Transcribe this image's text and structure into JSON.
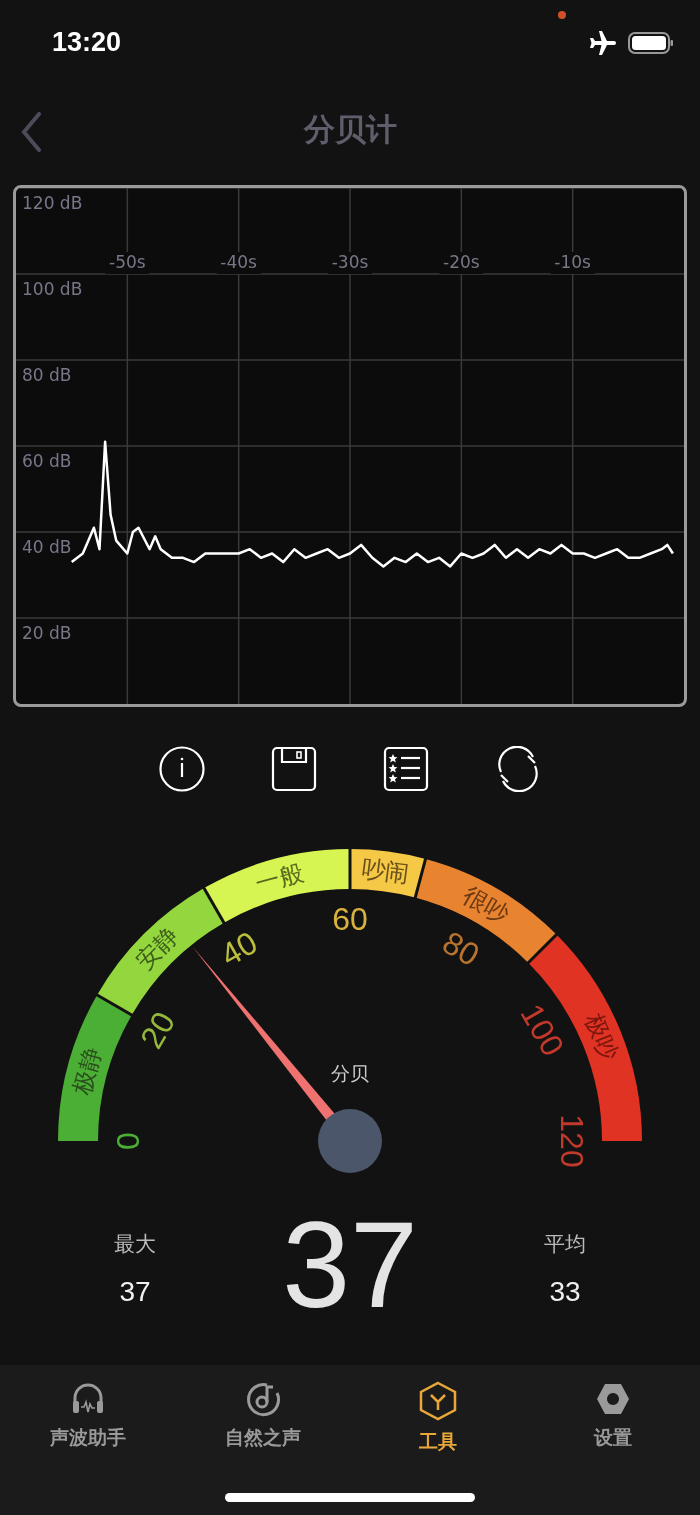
{
  "status_bar": {
    "time": "13:20"
  },
  "nav": {
    "title": "分贝计"
  },
  "chart": {
    "chart_data": {
      "type": "line",
      "grid": true,
      "xlim": [
        -60,
        0
      ],
      "ylim": [
        0,
        120
      ],
      "xticks": [
        {
          "value": -50,
          "label": "-50s"
        },
        {
          "value": -40,
          "label": "-40s"
        },
        {
          "value": -30,
          "label": "-30s"
        },
        {
          "value": -20,
          "label": "-20s"
        },
        {
          "value": -10,
          "label": "-10s"
        }
      ],
      "yticks": [
        {
          "value": 120,
          "label": "120 dB"
        },
        {
          "value": 100,
          "label": "100 dB"
        },
        {
          "value": 80,
          "label": "80 dB"
        },
        {
          "value": 60,
          "label": "60 dB"
        },
        {
          "value": 40,
          "label": "40 dB"
        },
        {
          "value": 20,
          "label": "20 dB"
        }
      ],
      "x": [
        -55,
        -54,
        -53,
        -52.5,
        -52,
        -51.5,
        -51,
        -50,
        -49.5,
        -49,
        -48,
        -47.5,
        -47,
        -46,
        -45,
        -44,
        -43,
        -42,
        -41,
        -40,
        -39,
        -38,
        -37,
        -36,
        -35,
        -34,
        -33,
        -32,
        -31,
        -30,
        -29,
        -28,
        -27,
        -26,
        -25,
        -24,
        -23,
        -22,
        -21,
        -20,
        -19,
        -18,
        -17,
        -16,
        -15,
        -14,
        -13,
        -12,
        -11,
        -10,
        -9,
        -8,
        -7,
        -6,
        -5,
        -4,
        -3,
        -2,
        -1.5,
        -1
      ],
      "series": [
        {
          "color": "#ffffff",
          "values": [
            33,
            35,
            41,
            36,
            61,
            44,
            38,
            35,
            40,
            41,
            36,
            39,
            36,
            34,
            34,
            33,
            35,
            35,
            35,
            35,
            36,
            34,
            35,
            33,
            36,
            34,
            35,
            36,
            34,
            35,
            37,
            34,
            32,
            34,
            33,
            35,
            33,
            34,
            32,
            35,
            34,
            35,
            37,
            34,
            36,
            34,
            36,
            35,
            37,
            35,
            35,
            34,
            35,
            36,
            34,
            34,
            35,
            36,
            37,
            35
          ]
        }
      ]
    }
  },
  "toolbar": [
    {
      "kind": "info"
    },
    {
      "kind": "save"
    },
    {
      "kind": "list"
    },
    {
      "kind": "refresh"
    }
  ],
  "gauge": {
    "unit": "分贝",
    "segments": [
      {
        "label": "极静",
        "color": "#4caf35"
      },
      {
        "label": "安静",
        "color": "#93d63e"
      },
      {
        "label": "一般",
        "color": "#d6f552"
      },
      {
        "label": "吵闹",
        "color": "#f5c846"
      },
      {
        "label": "很吵",
        "color": "#e88430"
      },
      {
        "label": "极吵",
        "color": "#e03323"
      }
    ],
    "ticks": [
      "0",
      "20",
      "40",
      "60",
      "80",
      "100",
      "120"
    ]
  },
  "stats": {
    "max": {
      "label": "最大",
      "value": "37"
    },
    "current": "37",
    "average": {
      "label": "平均",
      "value": "33"
    }
  },
  "tabs": [
    {
      "label": "声波助手",
      "selected": false
    },
    {
      "label": "自然之声",
      "selected": false
    },
    {
      "label": "工具",
      "selected": true
    },
    {
      "label": "设置",
      "selected": false
    }
  ]
}
